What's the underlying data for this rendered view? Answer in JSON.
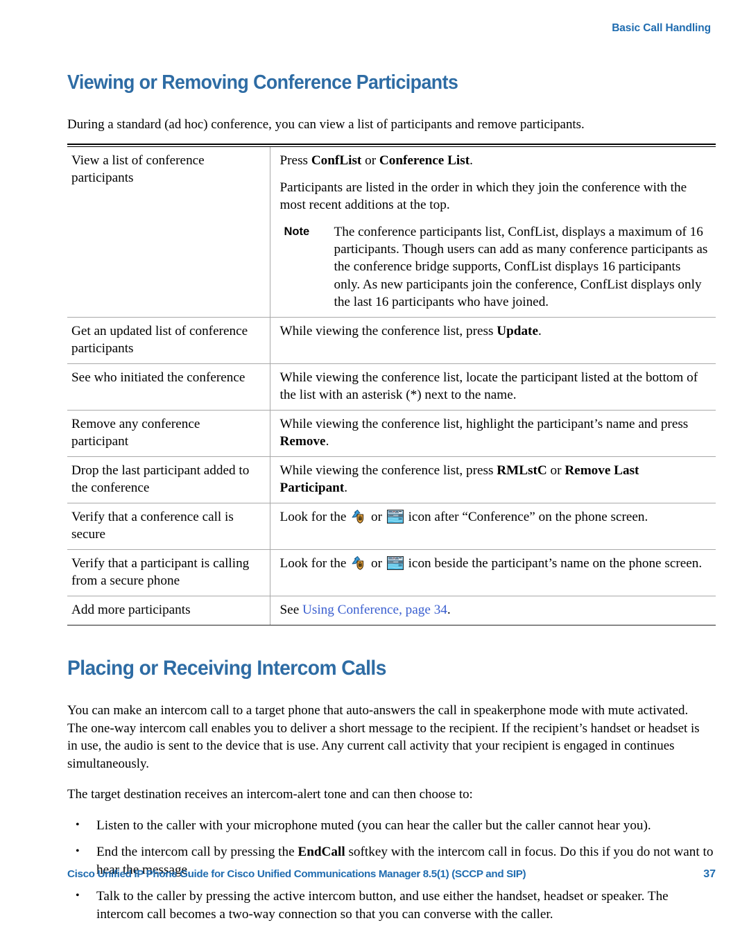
{
  "header": {
    "running_head": "Basic Call Handling",
    "accent_color": "#1f6cb0"
  },
  "section1": {
    "title": "Viewing or Removing Conference Participants",
    "intro": "During a standard (ad hoc) conference, you can view a list of participants and remove participants.",
    "table": {
      "rows": [
        {
          "task": "View a list of conference participants",
          "action_1_pre": "Press ",
          "action_1_b1": "ConfList",
          "action_1_mid": " or ",
          "action_1_b2": "Conference List",
          "action_1_post": ".",
          "action_2": "Participants are listed in the order in which they join the conference with the most recent additions at the top.",
          "note_label": "Note",
          "note_text": "The conference participants list, ConfList, displays a maximum of 16 participants. Though users can add as many conference participants as the conference bridge supports, ConfList displays 16 participants only. As new participants join the conference, ConfList displays only the last 16 participants who have joined."
        },
        {
          "task": "Get an updated list of conference participants",
          "action_pre": "While viewing the conference list, press ",
          "action_b": "Update",
          "action_post": "."
        },
        {
          "task": "See who initiated the conference",
          "action_plain": "While viewing the conference list, locate the participant listed at the bottom of the list with an asterisk (*) next to the name."
        },
        {
          "task": "Remove any conference participant",
          "action_pre": "While viewing the conference list, highlight the participant’s name and press ",
          "action_b": "Remove",
          "action_post": "."
        },
        {
          "task": "Drop the last participant added to the conference",
          "action_pre": "While viewing the conference list, press ",
          "action_b": "RMLstC",
          "action_mid": " or ",
          "action_b2": "Remove Last Participant",
          "action_post": "."
        },
        {
          "task": "Verify that a conference call is secure",
          "icon_pre": "Look for the ",
          "icon_1": "authenticated-call-shield-icon",
          "icon_mid": " or ",
          "icon_2": "encrypted-call-screen-icon",
          "icon_post": " icon after “Conference” on the phone screen."
        },
        {
          "task": "Verify that a participant is calling from a secure phone",
          "icon_pre": "Look for the ",
          "icon_1": "authenticated-call-shield-icon",
          "icon_mid": " or ",
          "icon_2": "encrypted-call-screen-icon",
          "icon_post": " icon beside the participant’s name on the phone screen."
        },
        {
          "task": "Add more participants",
          "xref_pre": "See ",
          "xref_link": "Using Conference, page 34",
          "xref_post": "."
        }
      ]
    }
  },
  "section2": {
    "title": "Placing or Receiving Intercom Calls",
    "para1": "You can make an intercom call to a target phone that auto-answers the call in speakerphone mode with mute activated. The one-way intercom call enables you to deliver a short message to the recipient. If the recipient’s handset or headset is in use, the audio is sent to the device that is use. Any current call activity that your recipient is engaged in continues simultaneously.",
    "para2": "The target destination receives an intercom-alert tone and can then choose to:",
    "bullets": [
      {
        "text_pre": "Listen to the caller with your microphone muted (you can hear the caller but the caller cannot hear you).",
        "bold": "",
        "text_post": ""
      },
      {
        "text_pre": "End the intercom call by pressing the ",
        "bold": "EndCall",
        "text_post": " softkey with the intercom call in focus. Do this if you do not want to hear the message."
      },
      {
        "text_pre": "Talk to the caller by pressing the active intercom button, and use either the handset, headset or speaker. The intercom call becomes a two-way connection so that you can converse with the caller.",
        "bold": "",
        "text_post": ""
      }
    ]
  },
  "footer": {
    "guide_title": "Cisco Unified IP Phone Guide for Cisco Unified Communications Manager 8.5(1) (SCCP and SIP)",
    "page_number": "37"
  },
  "colors": {
    "heading_blue": "#2e6ca4",
    "header_blue": "#1f6cb0",
    "xref_blue": "#3a5fd0",
    "rule_gray": "#a8a8a8"
  }
}
